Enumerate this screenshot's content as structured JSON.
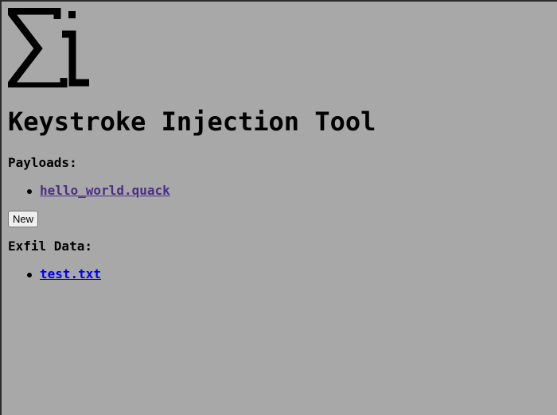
{
  "logo": {
    "icon": "sigma-i-logo",
    "alt": "Σi"
  },
  "title": "Keystroke Injection Tool",
  "payloads": {
    "heading": "Payloads:",
    "items": [
      {
        "label": "hello_world.quack"
      }
    ],
    "new_button": "New"
  },
  "exfil": {
    "heading": "Exfil Data:",
    "items": [
      {
        "label": "test.txt"
      }
    ]
  },
  "colors": {
    "background": "#a8a8a8",
    "visited_link": "#4b2d86",
    "unvisited_link": "#0000ee"
  }
}
